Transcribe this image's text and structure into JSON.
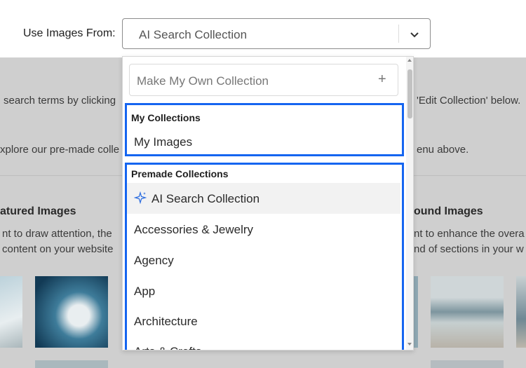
{
  "header": {
    "use_label": "Use Images From:",
    "selected_value": "AI Search Collection"
  },
  "background": {
    "line1_left": "search terms by clicking",
    "line1_right": "'Edit Collection' below.",
    "line2_left": "xplore our pre-made colle",
    "line2_right": "enu above.",
    "section_left_title": "atured Images",
    "section_left_text1": "nt to draw attention, the",
    "section_left_text2": "content on your website",
    "section_right_title": "ound Images",
    "section_right_text1": "nt to enhance the overa",
    "section_right_text2": "nd of sections in your w"
  },
  "dropdown": {
    "own_placeholder": "Make My Own Collection",
    "own_plus": "+",
    "my_collections": {
      "title": "My Collections",
      "items": [
        "My Images"
      ]
    },
    "premade": {
      "title": "Premade Collections",
      "items": [
        "AI Search Collection",
        "Accessories & Jewelry",
        "Agency",
        "App",
        "Architecture",
        "Arts & Crafts"
      ]
    }
  },
  "colors": {
    "highlight_border": "#1565f0",
    "sparkle": "#2f6fe0"
  }
}
